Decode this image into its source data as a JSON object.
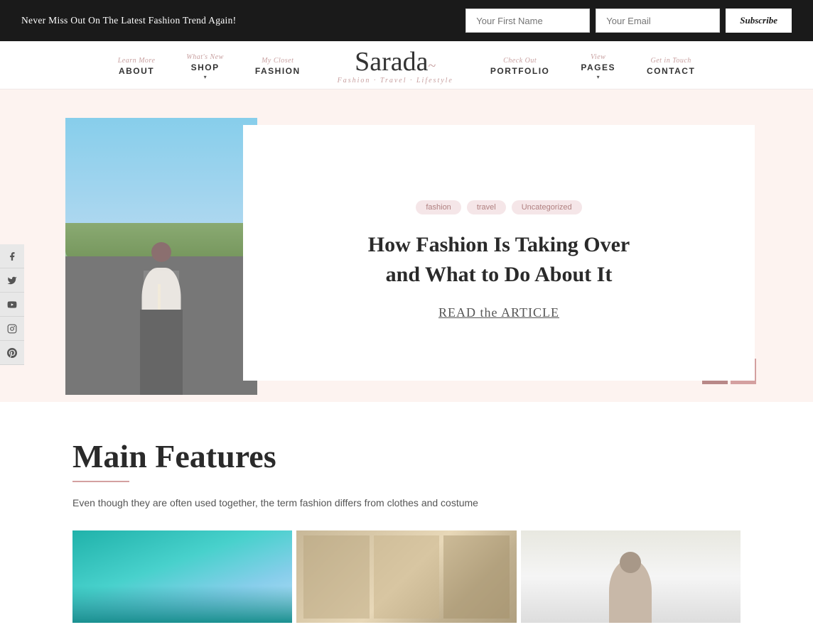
{
  "topbar": {
    "message": "Never Miss Out On The Latest Fashion Trend Again!",
    "first_name_placeholder": "Your First Name",
    "email_placeholder": "Your Email",
    "subscribe_label": "Subscribe"
  },
  "nav": {
    "items": [
      {
        "sub": "Learn More",
        "main": "ABOUT",
        "has_arrow": false
      },
      {
        "sub": "What's New",
        "main": "SHOP",
        "has_arrow": true
      },
      {
        "sub": "My Closet",
        "main": "FASHION",
        "has_arrow": false
      },
      {
        "sub": "Check Out",
        "main": "PORTFOLIO",
        "has_arrow": false
      },
      {
        "sub": "View",
        "main": "PAGES",
        "has_arrow": true
      },
      {
        "sub": "Get in Touch",
        "main": "CONTACT",
        "has_arrow": false
      }
    ]
  },
  "logo": {
    "title": "Sarada",
    "subtitle": "Fashion · Travel · Lifestyle"
  },
  "social": {
    "icons": [
      {
        "name": "facebook",
        "symbol": "f"
      },
      {
        "name": "twitter",
        "symbol": "t"
      },
      {
        "name": "youtube",
        "symbol": "▶"
      },
      {
        "name": "instagram",
        "symbol": "◻"
      },
      {
        "name": "pinterest",
        "symbol": "p"
      }
    ]
  },
  "hero": {
    "tags": [
      "fashion",
      "travel",
      "Uncategorized"
    ],
    "title": "How Fashion Is Taking Over and What to Do About It",
    "read_link": "READ the ARTICLE",
    "prev_arrow": "←",
    "next_arrow": "→"
  },
  "features": {
    "title": "Main Features",
    "underline_color": "#d4a0a0",
    "description": "Even though they are often used together, the term fashion differs from clothes and costume"
  }
}
